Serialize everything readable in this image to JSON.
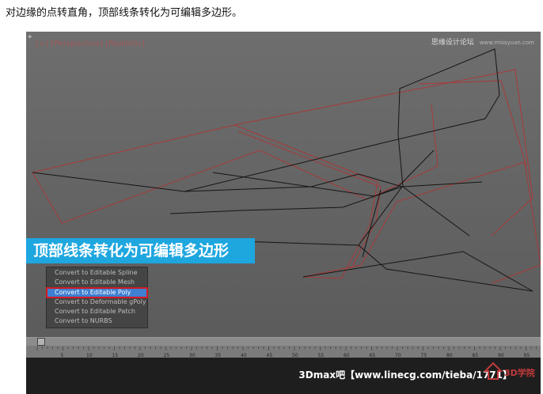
{
  "instruction": "对边缘的点转直角，顶部线条转化为可编辑多边形。",
  "viewport": {
    "label": "[+] [Perspective] [Realistic]",
    "corner_mark": "+",
    "watermark_top": "思缘设计论坛",
    "watermark_site": "www.missyuan.com",
    "caption": "顶部线条转化为可编辑多边形"
  },
  "quad_menu": {
    "items": [
      "Convert to Editable Spline",
      "Convert to Editable Mesh",
      "Convert to Editable Poly",
      "Convert to Deformable gPoly",
      "Convert to Editable Patch",
      "Convert to NURBS"
    ],
    "selected_index": 2
  },
  "timeline": {
    "slider_label": "0 / 100",
    "ticks": [
      "5",
      "10",
      "15",
      "20",
      "25",
      "30",
      "35",
      "40",
      "45",
      "50",
      "55",
      "60",
      "65",
      "70",
      "75",
      "80",
      "85",
      "90",
      "95"
    ]
  },
  "bottom_bar": {
    "text": "3Dmax吧【www.linecg.com/tieba/1771】",
    "logo_text": "3D学院"
  },
  "colors": {
    "red_line": "#a83a3a",
    "black_line": "#151515",
    "caption_bg": "#1ea6df",
    "menu_highlight": "#3f7fd1",
    "menu_outline": "#d11a22"
  }
}
